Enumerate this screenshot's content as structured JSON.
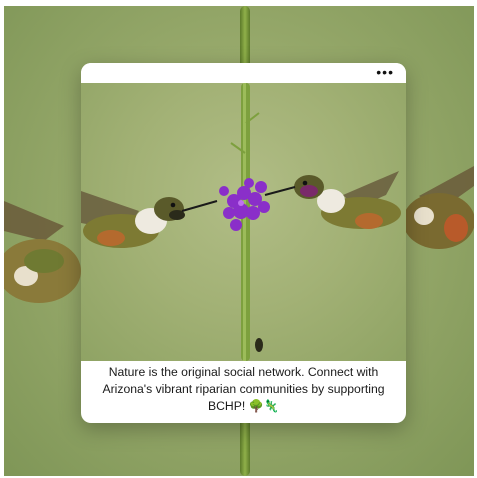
{
  "post": {
    "menu_icon": "more-horizontal-icon",
    "menu_glyph": "•••",
    "caption": "Nature is the original social network. Connect with Arizona's vibrant riparian communities by supporting BCHP! 🌳🦎"
  },
  "colors": {
    "background_green": "#97a96b",
    "card": "#ffffff",
    "flower": "#8a2fc9"
  }
}
